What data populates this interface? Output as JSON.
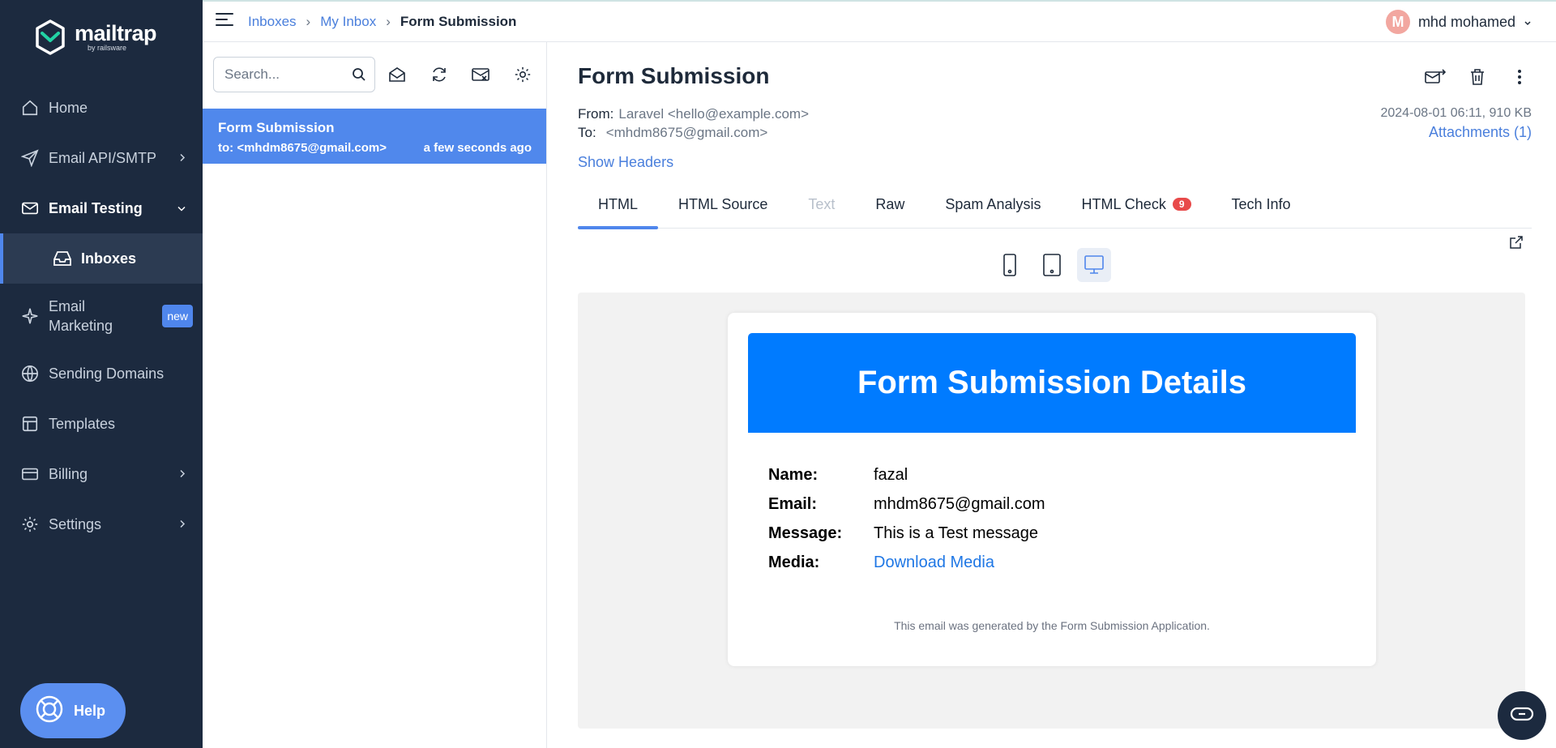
{
  "brand": {
    "name": "mailtrap",
    "sub": "by railsware"
  },
  "sidebar": {
    "items": [
      {
        "label": "Home",
        "icon": "home-icon"
      },
      {
        "label": "Email API/SMTP",
        "icon": "send-icon"
      },
      {
        "label": "Email Testing",
        "icon": "email-testing-icon"
      },
      {
        "label": "Inboxes",
        "icon": "inbox-icon"
      },
      {
        "label": "Email Marketing",
        "icon": "sparkle-icon",
        "badge": "new"
      },
      {
        "label": "Sending Domains",
        "icon": "globe-icon"
      },
      {
        "label": "Templates",
        "icon": "template-icon"
      },
      {
        "label": "Billing",
        "icon": "card-icon"
      },
      {
        "label": "Settings",
        "icon": "gear-icon"
      }
    ],
    "help_label": "Help"
  },
  "breadcrumb": {
    "items": [
      "Inboxes",
      "My Inbox"
    ],
    "current": "Form Submission"
  },
  "user": {
    "initial": "M",
    "name": "mhd mohamed"
  },
  "list": {
    "search_placeholder": "Search...",
    "messages": [
      {
        "subject": "Form Submission",
        "to": "to: <mhdm8675@gmail.com>",
        "time": "a few seconds ago"
      }
    ]
  },
  "message": {
    "title": "Form Submission",
    "from_label": "From:",
    "from_value": "Laravel <hello@example.com>",
    "to_label": "To:",
    "to_value": "<mhdm8675@gmail.com>",
    "date_size": "2024-08-01 06:11, 910 KB",
    "attachments": "Attachments (1)",
    "show_headers": "Show Headers",
    "tabs": [
      {
        "label": "HTML",
        "state": "active"
      },
      {
        "label": "HTML Source",
        "state": "normal"
      },
      {
        "label": "Text",
        "state": "disabled"
      },
      {
        "label": "Raw",
        "state": "normal"
      },
      {
        "label": "Spam Analysis",
        "state": "normal"
      },
      {
        "label": "HTML Check",
        "state": "normal",
        "badge": "9"
      },
      {
        "label": "Tech Info",
        "state": "normal"
      }
    ]
  },
  "email": {
    "heading": "Form Submission Details",
    "fields": [
      {
        "label": "Name:",
        "value": "fazal"
      },
      {
        "label": "Email:",
        "value": "mhdm8675@gmail.com"
      },
      {
        "label": "Message:",
        "value": "This is a Test message"
      },
      {
        "label": "Media:",
        "value": "Download Media"
      }
    ],
    "footer": "This email was generated by the Form Submission Application."
  },
  "colors": {
    "sidebar_bg": "#1c2a3f",
    "accent": "#4f86ec",
    "email_header": "#007bff",
    "badge_red": "#e84a4a"
  }
}
